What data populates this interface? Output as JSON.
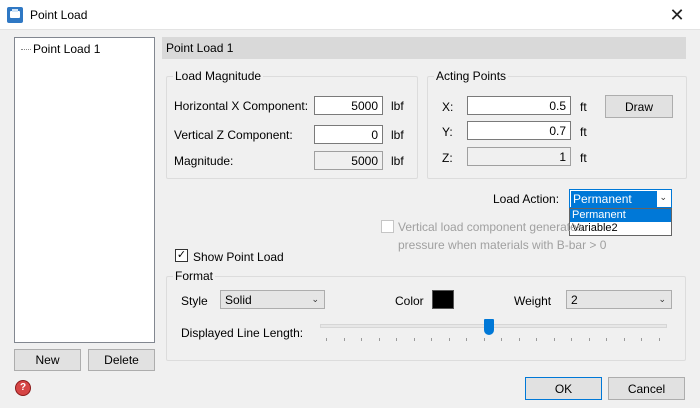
{
  "window": {
    "title": "Point Load",
    "close_glyph": "✕",
    "icon": "app-window-icon"
  },
  "tree": {
    "items": [
      {
        "label": "Point Load 1"
      }
    ]
  },
  "left_buttons": {
    "new_label": "New",
    "delete_label": "Delete"
  },
  "header": {
    "title": "Point Load 1"
  },
  "load_magnitude": {
    "legend": "Load Magnitude",
    "rows": [
      {
        "label": "Horizontal X Component:",
        "value": "5000",
        "unit": "lbf"
      },
      {
        "label": "Vertical Z Component:",
        "value": "0",
        "unit": "lbf"
      },
      {
        "label": "Magnitude:",
        "value": "5000",
        "unit": "lbf"
      }
    ]
  },
  "acting_points": {
    "legend": "Acting Points",
    "rows": [
      {
        "label": "X:",
        "value": "0.5",
        "unit": "ft"
      },
      {
        "label": "Y:",
        "value": "0.7",
        "unit": "ft"
      },
      {
        "label": "Z:",
        "value": "1",
        "unit": "ft"
      }
    ],
    "draw_label": "Draw"
  },
  "load_action": {
    "label": "Load Action:",
    "selected": "Permanent",
    "options": [
      "Permanent",
      "Variable2"
    ]
  },
  "vertical_pressure": {
    "line1": "Vertical load component generates",
    "line2": "pressure when materials with B-bar > 0",
    "checked": false
  },
  "show_point_load": {
    "label": "Show Point Load",
    "checked": true,
    "check_glyph": "✓"
  },
  "format": {
    "legend": "Format",
    "style_label": "Style",
    "style_value": "Solid",
    "color_label": "Color",
    "color_value": "#000000",
    "weight_label": "Weight",
    "weight_value": "2",
    "line_length_label": "Displayed Line Length:",
    "line_length_fraction": 0.5
  },
  "footer": {
    "ok_label": "OK",
    "cancel_label": "Cancel",
    "help_glyph": "?"
  },
  "colors": {
    "accent": "#0078d7"
  }
}
